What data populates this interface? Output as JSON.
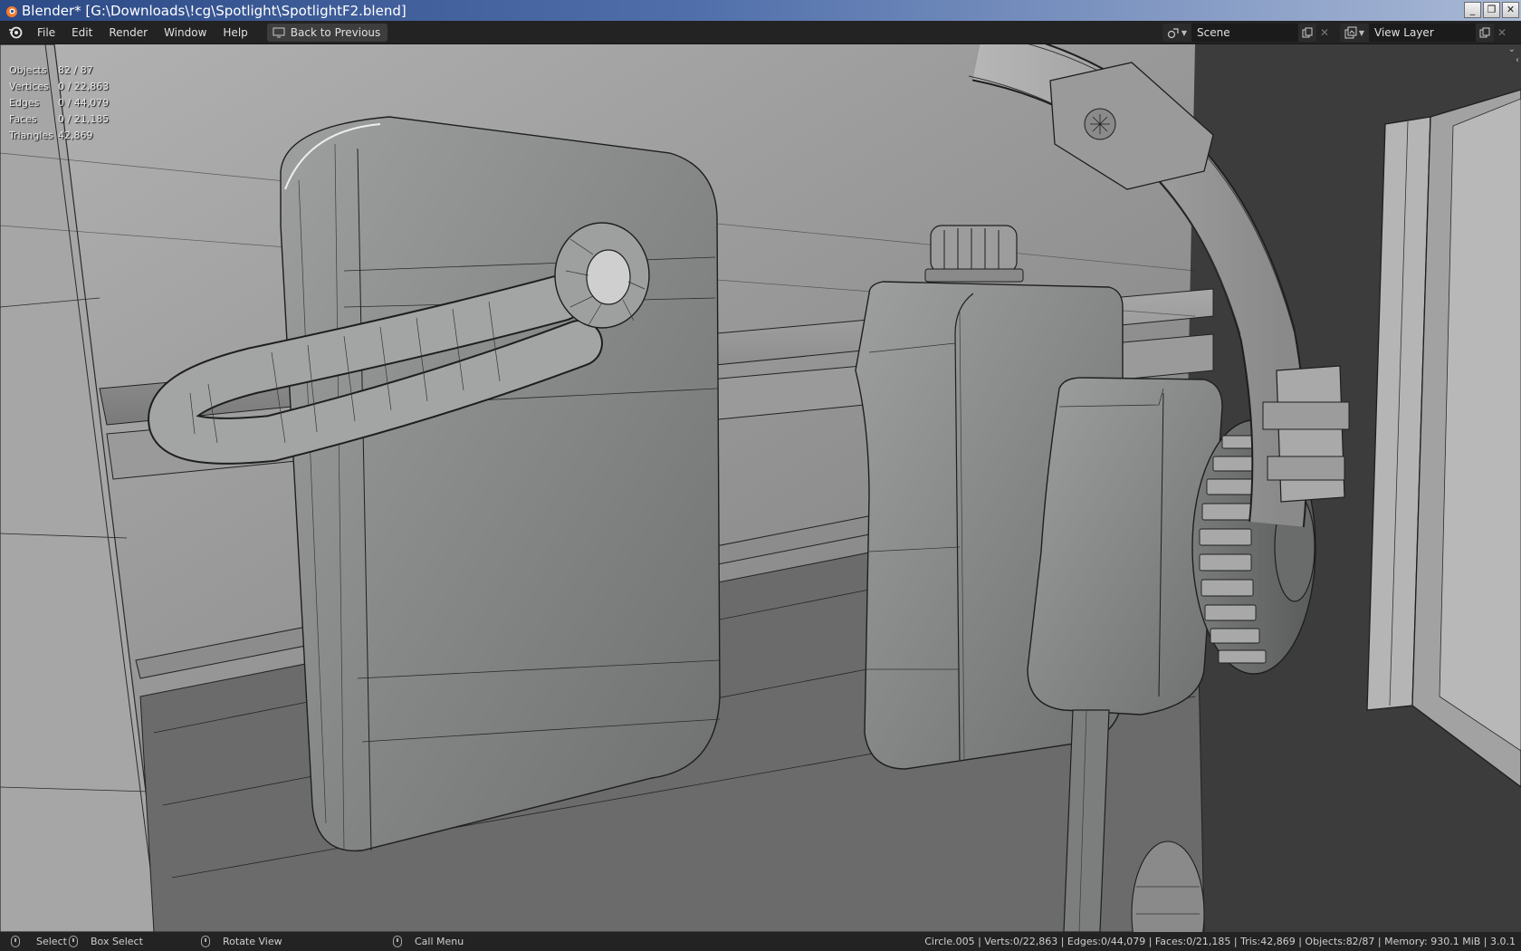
{
  "window": {
    "title": "Blender* [G:\\Downloads\\!cg\\Spotlight\\SpotlightF2.blend]",
    "controls": {
      "minimize": "_",
      "restore": "❐",
      "close": "✕"
    }
  },
  "menubar": {
    "items": [
      "File",
      "Edit",
      "Render",
      "Window",
      "Help"
    ],
    "back_button": "Back to Previous",
    "scene": {
      "name": "Scene"
    },
    "view_layer": {
      "name": "View Layer"
    }
  },
  "viewport": {
    "stats": [
      {
        "label": "Objects",
        "value": "82 / 87"
      },
      {
        "label": "Vertices",
        "value": "0 / 22,863"
      },
      {
        "label": "Edges",
        "value": "0 / 44,079"
      },
      {
        "label": "Faces",
        "value": "0 / 21,185"
      },
      {
        "label": "Triangles",
        "value": "42,869"
      }
    ]
  },
  "statusbar": {
    "select": "Select",
    "box_select": "Box Select",
    "rotate_view": "Rotate View",
    "call_menu": "Call Menu",
    "info": "Circle.005 | Verts:0/22,863 | Edges:0/44,079 | Faces:0/21,185 | Tris:42,869 | Objects:82/87 | Memory: 930.1 MiB | 3.0.1"
  },
  "colors": {
    "titlebar_start": "#2c4a86",
    "ui_dark": "#232323",
    "viewport_bg": "#3a3a3a",
    "mesh_grey": "#8c8c8c"
  }
}
